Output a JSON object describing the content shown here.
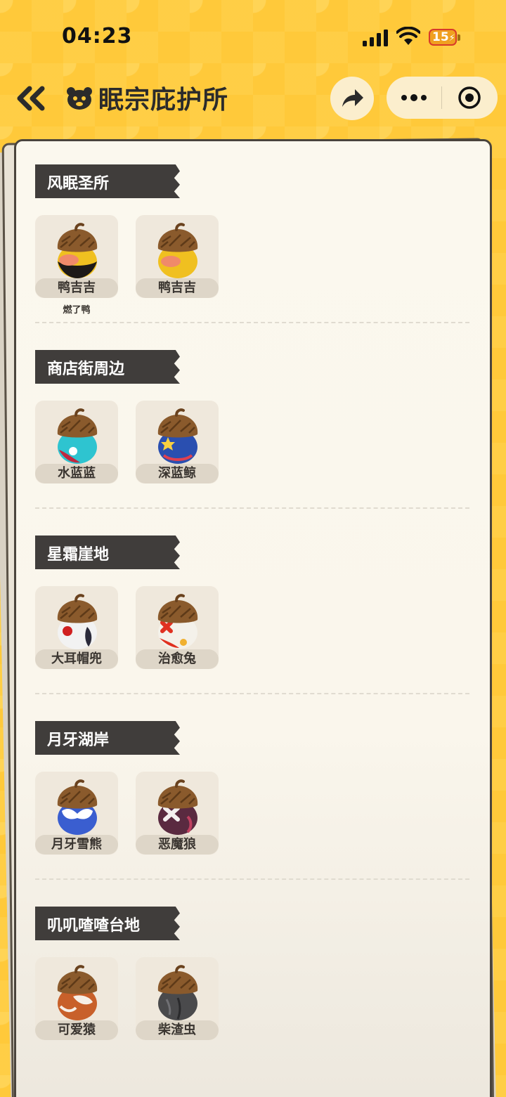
{
  "status_bar": {
    "time": "04:23",
    "battery": "15"
  },
  "header": {
    "title": "眠宗庇护所"
  },
  "sections": [
    {
      "title": "风眠圣所",
      "items": [
        {
          "label": "鸭吉吉",
          "caption": "燃了鸭"
        },
        {
          "label": "鸭吉吉"
        }
      ]
    },
    {
      "title": "商店街周边",
      "items": [
        {
          "label": "水蓝蓝"
        },
        {
          "label": "深蓝鲸"
        }
      ]
    },
    {
      "title": "星霜崖地",
      "items": [
        {
          "label": "大耳帽兜"
        },
        {
          "label": "治愈兔"
        }
      ]
    },
    {
      "title": "月牙湖岸",
      "items": [
        {
          "label": "月牙雪熊"
        },
        {
          "label": "恶魔狼"
        }
      ]
    },
    {
      "title": "叽叽喳喳台地",
      "items": [
        {
          "label": "可爱猿"
        },
        {
          "label": "柴渣虫"
        }
      ]
    }
  ],
  "colors": {
    "background": "#ffc93a",
    "section_header": "#403d3b",
    "paper": "#fbf8ee",
    "acorn_cap": "#8a5a2c"
  },
  "icons": [
    "back-double-chevron-icon",
    "mascot-icon",
    "share-icon",
    "more-icon",
    "target-icon"
  ]
}
